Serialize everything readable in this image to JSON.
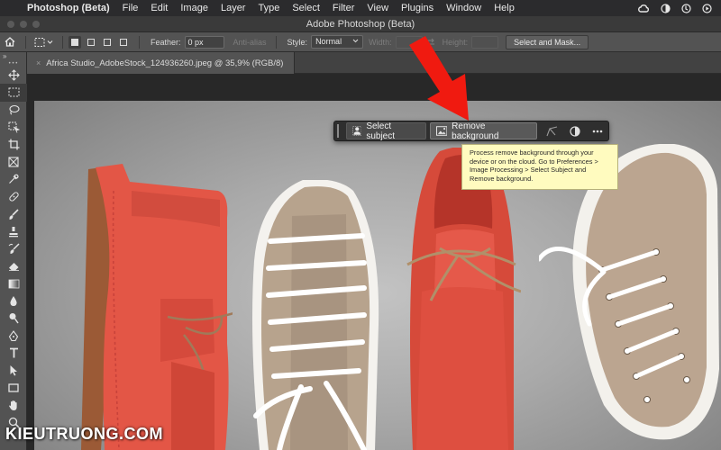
{
  "menubar": {
    "app_name": "Photoshop (Beta)",
    "items": [
      "File",
      "Edit",
      "Image",
      "Layer",
      "Type",
      "Select",
      "Filter",
      "View",
      "Plugins",
      "Window",
      "Help"
    ]
  },
  "window": {
    "title": "Adobe Photoshop (Beta)"
  },
  "options_bar": {
    "feather_label": "Feather:",
    "feather_value": "0 px",
    "anti_alias_label": "Anti-alias",
    "style_label": "Style:",
    "style_value": "Normal",
    "width_label": "Width:",
    "height_label": "Height:",
    "select_and_mask_label": "Select and Mask..."
  },
  "document": {
    "tab_label": "Africa Studio_AdobeStock_124936260.jpeg @ 35,9% (RGB/8)"
  },
  "contextual_taskbar": {
    "select_subject_label": "Select subject",
    "remove_background_label": "Remove background"
  },
  "tooltip": {
    "text": "Process remove background through your device or on the cloud. Go to Preferences > Image Processing > Select Subject and Remove background."
  },
  "watermark": "KIEUTRUONG.COM",
  "colors": {
    "arrow": "#f01a10",
    "tooltip_bg": "#fffbbf",
    "panel": "#535353"
  },
  "icons": {
    "toolbar": [
      "move-icon",
      "marquee-icon",
      "lasso-icon",
      "object-select-icon",
      "crop-icon",
      "frame-icon",
      "eyedropper-icon",
      "healing-brush-icon",
      "brush-icon",
      "clone-stamp-icon",
      "history-brush-icon",
      "eraser-icon",
      "gradient-icon",
      "blur-icon",
      "dodge-icon",
      "pen-icon",
      "type-icon",
      "path-select-icon",
      "rectangle-icon",
      "hand-icon",
      "zoom-icon"
    ]
  }
}
